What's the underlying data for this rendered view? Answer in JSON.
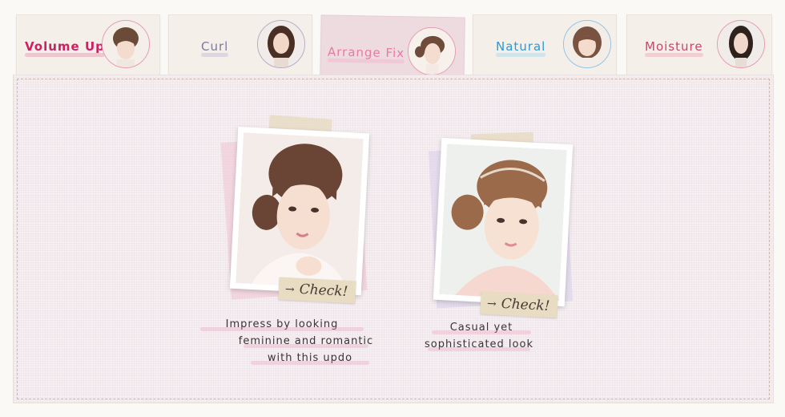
{
  "tabs": [
    {
      "label": "Volume Up",
      "color": "#d01e62",
      "underline": "#e37aa1"
    },
    {
      "label": "Curl",
      "color": "#7d7a9b",
      "underline": "#b1accf"
    },
    {
      "label": "Arrange Fix",
      "color": "#e97aa4",
      "underline": "#f2aac5",
      "active": true
    },
    {
      "label": "Natural",
      "color": "#2c98db",
      "underline": "#8fcdf2"
    },
    {
      "label": "Moisture",
      "color": "#d04268",
      "underline": "#e891a9"
    }
  ],
  "cards": [
    {
      "check_label": "Check!",
      "arrow": "→",
      "caption": [
        "Impress by looking",
        "feminine and romantic",
        "with this updo"
      ],
      "shadow_color": "#f2c6d4"
    },
    {
      "check_label": "Check!",
      "arrow": "→",
      "caption": [
        "Casual yet",
        "sophisticated look"
      ],
      "shadow_color": "#d7cde9"
    }
  ]
}
